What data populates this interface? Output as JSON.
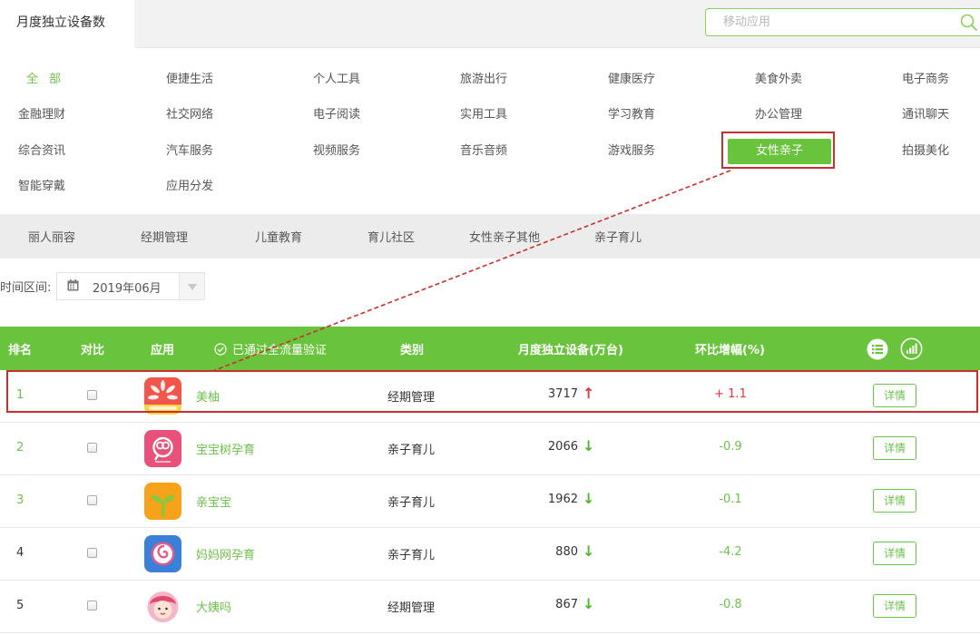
{
  "header": {
    "active_tab": "月度独立设备数",
    "search_placeholder": "移动应用"
  },
  "categories": {
    "all": "全 部",
    "items": [
      "便捷生活",
      "个人工具",
      "旅游出行",
      "健康医疗",
      "美食外卖",
      "电子商务",
      "金融理财",
      "社交网络",
      "电子阅读",
      "实用工具",
      "学习教育",
      "办公管理",
      "通讯聊天",
      "综合资讯",
      "汽车服务",
      "视频服务",
      "音乐音频",
      "游戏服务",
      "女性亲子",
      "拍摄美化",
      "智能穿戴",
      "应用分发"
    ],
    "selected": "女性亲子"
  },
  "subcategories": [
    "丽人丽容",
    "经期管理",
    "儿童教育",
    "育儿社区",
    "女性亲子其他",
    "亲子育儿"
  ],
  "time_range": {
    "label": "时间区间:",
    "value": "2019年06月"
  },
  "table": {
    "headers": {
      "rank": "排名",
      "compare": "对比",
      "app": "应用",
      "verified": "已通过全流量验证",
      "category": "类别",
      "devices": "月度独立设备(万台)",
      "growth": "环比增幅(%)"
    },
    "detail_label": "详情",
    "rows": [
      {
        "rank": "1",
        "name": "美柚",
        "category": "经期管理",
        "devices": "3717",
        "trend": "up",
        "growth": "+ 1.1"
      },
      {
        "rank": "2",
        "name": "宝宝树孕育",
        "category": "亲子育儿",
        "devices": "2066",
        "trend": "down",
        "growth": "-0.9"
      },
      {
        "rank": "3",
        "name": "亲宝宝",
        "category": "亲子育儿",
        "devices": "1962",
        "trend": "down",
        "growth": "-0.1"
      },
      {
        "rank": "4",
        "name": "妈妈网孕育",
        "category": "亲子育儿",
        "devices": "880",
        "trend": "down",
        "growth": "-4.2"
      },
      {
        "rank": "5",
        "name": "大姨吗",
        "category": "经期管理",
        "devices": "867",
        "trend": "down",
        "growth": "-0.8"
      }
    ]
  },
  "colors": {
    "accent_green": "#6ac33c",
    "highlight_red": "#c9302c",
    "up_red": "#d9363e",
    "down_green": "#52b52c"
  }
}
